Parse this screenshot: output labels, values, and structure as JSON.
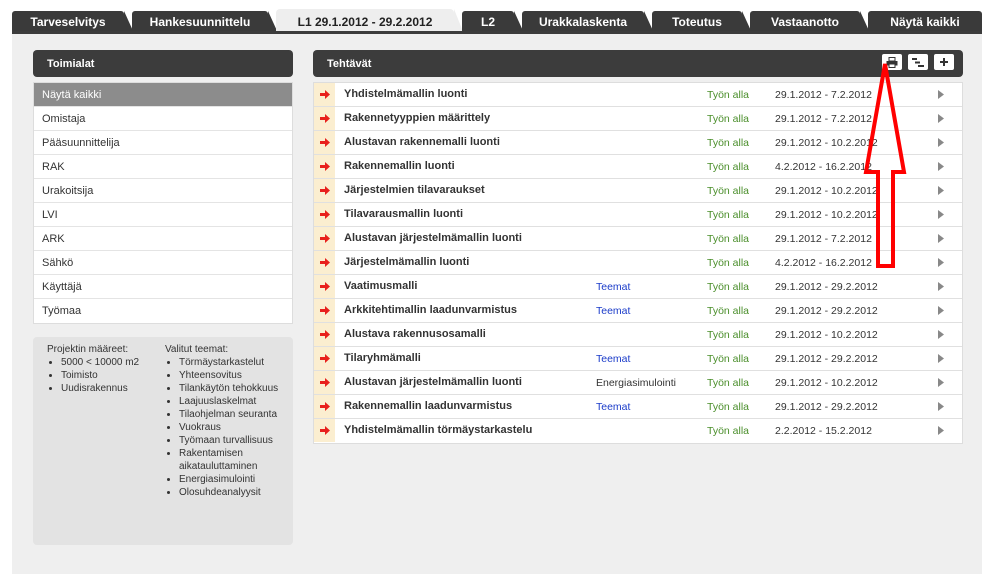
{
  "tabs": [
    {
      "label": "Tarveselvitys"
    },
    {
      "label": "Hankesuunnittelu"
    },
    {
      "label": "L1 29.1.2012 - 29.2.2012"
    },
    {
      "label": "L2"
    },
    {
      "label": "Urakkalaskenta"
    },
    {
      "label": "Toteutus"
    },
    {
      "label": "Vastaanotto"
    },
    {
      "label": "Näytä kaikki"
    }
  ],
  "sidebar": {
    "title": "Toimialat",
    "items": [
      {
        "label": "Näytä kaikki"
      },
      {
        "label": "Omistaja"
      },
      {
        "label": "Pääsuunnittelija"
      },
      {
        "label": "RAK"
      },
      {
        "label": "Urakoitsija"
      },
      {
        "label": "LVI"
      },
      {
        "label": "ARK"
      },
      {
        "label": "Sähkö"
      },
      {
        "label": "Käyttäjä"
      },
      {
        "label": "Työmaa"
      }
    ]
  },
  "info": {
    "project_title": "Projektin määreet:",
    "project_items": [
      "5000 < 10000 m2",
      "Toimisto",
      "Uudisrakennus"
    ],
    "themes_title": "Valitut teemat:",
    "themes_items": [
      "Törmäystarkastelut",
      "Yhteensovitus",
      "Tilankäytön tehokkuus",
      "Laajuuslaskelmat",
      "Tilaohjelman seuranta",
      "Vuokraus",
      "Työmaan turvallisuus",
      "Rakentamisen aikatauluttaminen",
      "Energiasimulointi",
      "Olosuhdeanalyysit"
    ]
  },
  "tasks": {
    "title": "Tehtävät",
    "rows": [
      {
        "name": "Yhdistelmämallin luonti",
        "theme": "",
        "status": "Työn alla",
        "dates": "29.1.2012 - 7.2.2012"
      },
      {
        "name": "Rakennetyyppien määrittely",
        "theme": "",
        "status": "Työn alla",
        "dates": "29.1.2012 - 7.2.2012"
      },
      {
        "name": "Alustavan rakennemalli luonti",
        "theme": "",
        "status": "Työn alla",
        "dates": "29.1.2012 - 10.2.2012"
      },
      {
        "name": "Rakennemallin luonti",
        "theme": "",
        "status": "Työn alla",
        "dates": "4.2.2012 - 16.2.2012"
      },
      {
        "name": "Järjestelmien tilavaraukset",
        "theme": "",
        "status": "Työn alla",
        "dates": "29.1.2012 - 10.2.2012"
      },
      {
        "name": "Tilavarausmallin luonti",
        "theme": "",
        "status": "Työn alla",
        "dates": "29.1.2012 - 10.2.2012"
      },
      {
        "name": "Alustavan järjestelmämallin luonti",
        "theme": "",
        "status": "Työn alla",
        "dates": "29.1.2012 - 7.2.2012"
      },
      {
        "name": "Järjestelmämallin luonti",
        "theme": "",
        "status": "Työn alla",
        "dates": "4.2.2012 - 16.2.2012"
      },
      {
        "name": "Vaatimusmalli",
        "theme": "Teemat",
        "status": "Työn alla",
        "dates": "29.1.2012 - 29.2.2012"
      },
      {
        "name": "Arkkitehtimallin laadunvarmistus",
        "theme": "Teemat",
        "status": "Työn alla",
        "dates": "29.1.2012 - 29.2.2012"
      },
      {
        "name": "Alustava rakennusosamalli",
        "theme": "",
        "status": "Työn alla",
        "dates": "29.1.2012 - 10.2.2012"
      },
      {
        "name": "Tilaryhmämalli",
        "theme": "Teemat",
        "status": "Työn alla",
        "dates": "29.1.2012 - 29.2.2012"
      },
      {
        "name": "Alustavan järjestelmämallin luonti",
        "theme": "Energiasimulointi",
        "status": "Työn alla",
        "dates": "29.1.2012 - 10.2.2012"
      },
      {
        "name": "Rakennemallin laadunvarmistus",
        "theme": "Teemat",
        "status": "Työn alla",
        "dates": "29.1.2012 - 29.2.2012"
      },
      {
        "name": "Yhdistelmämallin törmäystarkastelu",
        "theme": "",
        "status": "Työn alla",
        "dates": "2.2.2012 - 15.2.2012"
      }
    ]
  },
  "icons": {
    "toolbar": [
      "print-icon",
      "gantt-icon",
      "add-icon"
    ],
    "row_marker": "red-arrow-icon",
    "row_chevron": "chevron-right-icon"
  },
  "colors": {
    "accent_status": "#4a8e2a",
    "link": "#1a3bc9",
    "marker": "#e8201c",
    "annotation": "#ff0000"
  }
}
